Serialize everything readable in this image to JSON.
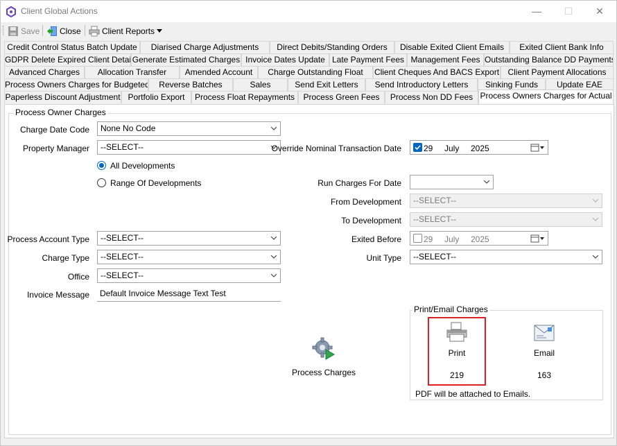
{
  "window": {
    "title": "Client Global Actions",
    "minimize": "—",
    "maximize": "☐",
    "close": "✕"
  },
  "toolbar": {
    "save": "Save",
    "close": "Close",
    "client_reports": "Client Reports"
  },
  "tabs": {
    "row1": [
      "Credit Control Status Batch Update",
      "Diarised Charge Adjustments",
      "Direct Debits/Standing Orders",
      "Disable Exited Client Emails",
      "Exited Client Bank Info"
    ],
    "row2": [
      "GDPR Delete Expired Client Details",
      "Generate Estimated Charges",
      "Invoice Dates Update",
      "Late Payment Fees",
      "Management Fees",
      "Outstanding Balance DD Payments"
    ],
    "row3": [
      "Advanced Charges",
      "Allocation Transfer",
      "Amended Account",
      "Charge Outstanding Float",
      "Client Cheques And BACS Export",
      "Client Payment Allocations"
    ],
    "row4": [
      "Process Owners Charges for Budgeted",
      "Reverse  Batches",
      "Sales",
      "Send Exit Letters",
      "Send Introductory Letters",
      "Sinking Funds",
      "Update EAE"
    ],
    "row5": [
      "Paperless Discount Adjustment",
      "Portfolio Export",
      "Process Float Repayments",
      "Process Green Fees",
      "Process Non DD Fees",
      "Process Owners Charges for Actual"
    ]
  },
  "form": {
    "group_title": "Process Owner Charges",
    "charge_date_code": {
      "label": "Charge Date Code",
      "value": "None No Code"
    },
    "property_manager": {
      "label": "Property Manager",
      "value": "--SELECT--"
    },
    "all_developments": "All Developments",
    "range_of_developments": "Range Of Developments",
    "override_date": {
      "label": "Override Nominal Transaction Date",
      "day": "29",
      "month": "July",
      "year": "2025",
      "checked": true
    },
    "run_charges_for_date": {
      "label": "Run Charges For Date",
      "value": ""
    },
    "from_development": {
      "label": "From Development",
      "value": "--SELECT--"
    },
    "to_development": {
      "label": "To Development",
      "value": "--SELECT--"
    },
    "process_account_type": {
      "label": "Process Account Type",
      "value": "--SELECT--"
    },
    "exited_before": {
      "label": "Exited Before",
      "day": "29",
      "month": "July",
      "year": "2025",
      "checked": false
    },
    "charge_type": {
      "label": "Charge Type",
      "value": "--SELECT--"
    },
    "unit_type": {
      "label": "Unit Type",
      "value": "--SELECT--"
    },
    "office": {
      "label": "Office",
      "value": "--SELECT--"
    },
    "invoice_message": {
      "label": "Invoice Message",
      "value": "Default Invoice Message Text Test"
    }
  },
  "actions": {
    "process_charges": "Process Charges",
    "print_email_title": "Print/Email Charges",
    "print_label": "Print",
    "print_count": "219",
    "email_label": "Email",
    "email_count": "163",
    "pdf_note": "PDF will be attached to Emails."
  },
  "colors": {
    "accent": "#0067c0",
    "highlight": "#e02020"
  }
}
